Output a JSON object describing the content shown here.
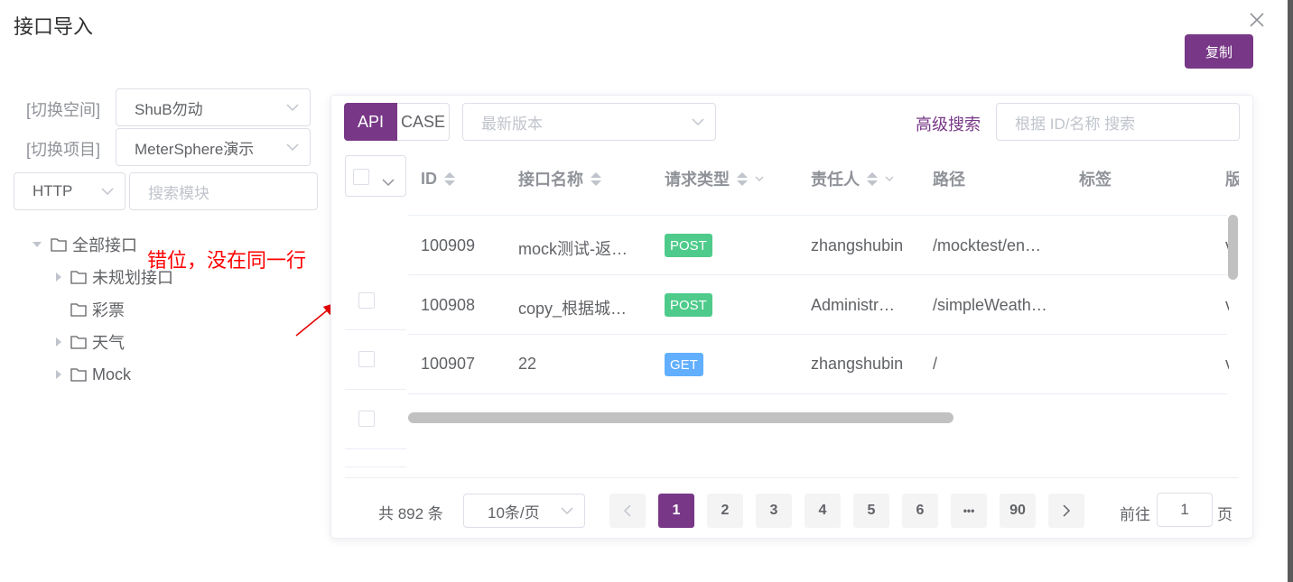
{
  "dialog": {
    "title": "接口导入",
    "copy_label": "复制"
  },
  "left": {
    "space_label": "[切换空间]",
    "space_value": "ShuB勿动",
    "project_label": "[切换项目]",
    "project_value": "MeterSphere演示",
    "protocol_value": "HTTP",
    "module_search_placeholder": "搜索模块",
    "tree": [
      {
        "label": "全部接口",
        "expanded": true
      },
      {
        "label": "未规划接口"
      },
      {
        "label": "彩票"
      },
      {
        "label": "天气"
      },
      {
        "label": "Mock"
      }
    ]
  },
  "annotation": "错位，没在同一行",
  "panel": {
    "tab_api": "API",
    "tab_case": "CASE",
    "version_placeholder": "最新版本",
    "advanced_search": "高级搜索",
    "search_placeholder": "根据 ID/名称 搜索",
    "columns": [
      "ID",
      "接口名称",
      "请求类型",
      "责任人",
      "路径",
      "标签",
      "版"
    ],
    "rows": [
      {
        "id": "100909",
        "name": "mock测试-返…",
        "method": "POST",
        "owner": "zhangshubin",
        "path": "/mocktest/en…",
        "ver": "v"
      },
      {
        "id": "100908",
        "name": "copy_根据城…",
        "method": "POST",
        "owner": "Administr…",
        "path": "/simpleWeath…",
        "ver": "v"
      },
      {
        "id": "100907",
        "name": "22",
        "method": "GET",
        "owner": "zhangshubin",
        "path": "/",
        "ver": "v"
      }
    ],
    "colors": {
      "post": "#4ecb8b",
      "get": "#61affe",
      "accent": "#783887"
    }
  },
  "pagination": {
    "total": "共 892 条",
    "page_size": "10条/页",
    "pages": [
      "1",
      "2",
      "3",
      "4",
      "5",
      "6",
      "•••",
      "90"
    ],
    "current": "1",
    "goto_label": "前往",
    "goto_value": "1",
    "page_suffix": "页"
  }
}
